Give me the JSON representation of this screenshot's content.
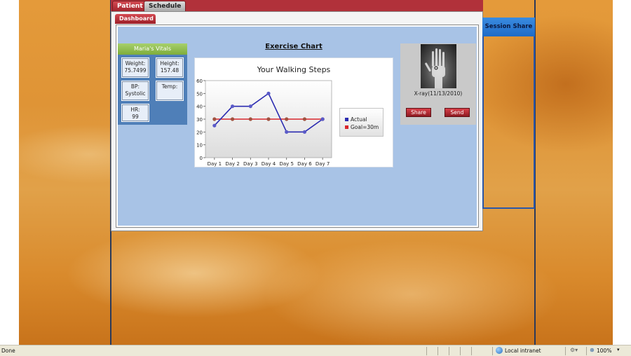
{
  "tabs": {
    "patient": "Patient",
    "schedule": "Schedule",
    "dashboard": "Dashboard"
  },
  "vitals": {
    "title": "Maria's Vitals",
    "weight": {
      "label": "Weight:",
      "value": "75.7499"
    },
    "height": {
      "label": "Height:",
      "value": "157.48"
    },
    "bp": {
      "label": "BP:",
      "value": "Systolic"
    },
    "temp": {
      "label": "Temp:",
      "value": ""
    },
    "hr": {
      "label": "HR:",
      "value": "99"
    }
  },
  "exercise": {
    "title": "Exercise Chart"
  },
  "chart_data": {
    "type": "line",
    "title": "Your Walking Steps",
    "categories": [
      "Day 1",
      "Day 2",
      "Day 3",
      "Day 4",
      "Day 5",
      "Day 6",
      "Day 7"
    ],
    "series": [
      {
        "name": "Actual",
        "values": [
          25,
          40,
          40,
          50,
          20,
          20,
          30
        ],
        "color": "#2b2bb0"
      },
      {
        "name": "Goal=30m",
        "values": [
          30,
          30,
          30,
          30,
          30,
          30,
          30
        ],
        "color": "#d9262c"
      }
    ],
    "ylim": [
      0,
      60
    ],
    "yticks": [
      0,
      10,
      20,
      30,
      40,
      50,
      60
    ],
    "legend": "right"
  },
  "xray": {
    "caption": "X-ray(11/13/2010)",
    "share_label": "Share",
    "send_label": "Send"
  },
  "session": {
    "title": "Session Share"
  },
  "status": {
    "left_text": "Done",
    "zone": "Local intranet",
    "zoom": "100%"
  },
  "colors": {
    "accent_red": "#b1313a",
    "panel_blue": "#a8c3e6",
    "vitals_blue": "#4f7fb8",
    "session_blue": "#1e6bc7"
  }
}
